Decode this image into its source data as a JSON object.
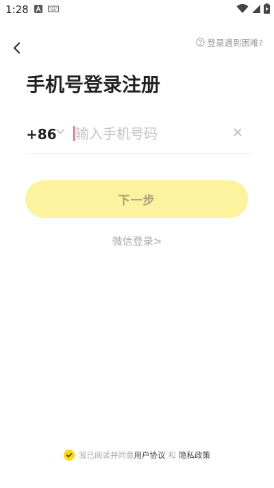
{
  "status_bar": {
    "time": "1:28"
  },
  "header": {
    "back_icon": "chevron-left-icon",
    "help_label": "登录遇到困难?",
    "help_icon": "question-circle-icon"
  },
  "title": "手机号登录注册",
  "phone": {
    "country_code": "+86",
    "placeholder": "输入手机号码",
    "value": ""
  },
  "next_button_label": "下一步",
  "wechat_login_label": "微信登录>",
  "agreement": {
    "prefix": "我已阅读并同意",
    "user_agreement": "用户协议",
    "conjunction": "和",
    "privacy_policy": "隐私政策",
    "checked": true
  },
  "colors": {
    "accent": "#ffd900",
    "button_bg": "#fdf39e",
    "cursor": "#ff4d7a"
  }
}
